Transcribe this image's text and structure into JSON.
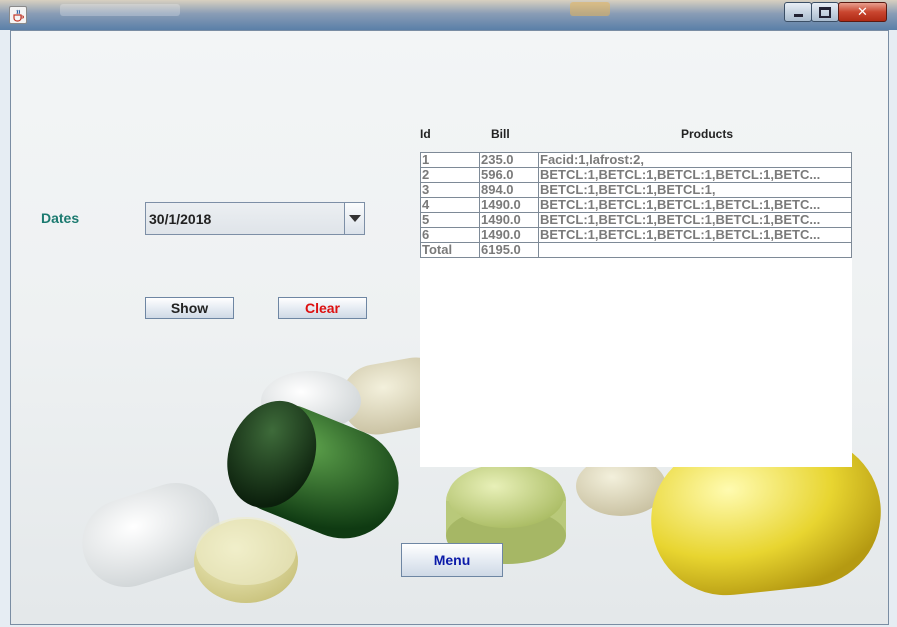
{
  "window": {
    "icons": {
      "app": "java-cup-icon",
      "minimize": "minimize-icon",
      "maximize": "maximize-icon",
      "close": "close-icon"
    },
    "close_glyph": "✕"
  },
  "form": {
    "dates_label": "Dates",
    "date_value": "30/1/2018",
    "show_label": "Show",
    "clear_label": "Clear",
    "menu_label": "Menu"
  },
  "table": {
    "headers": {
      "id": "Id",
      "bill": "Bill",
      "products": "Products"
    },
    "rows": [
      {
        "id": "1",
        "bill": "235.0",
        "products": "Facid:1,lafrost:2,"
      },
      {
        "id": "2",
        "bill": "596.0",
        "products": "BETCL:1,BETCL:1,BETCL:1,BETCL:1,BETC..."
      },
      {
        "id": "3",
        "bill": "894.0",
        "products": "BETCL:1,BETCL:1,BETCL:1,"
      },
      {
        "id": "4",
        "bill": "1490.0",
        "products": "BETCL:1,BETCL:1,BETCL:1,BETCL:1,BETC..."
      },
      {
        "id": "5",
        "bill": "1490.0",
        "products": "BETCL:1,BETCL:1,BETCL:1,BETCL:1,BETC..."
      },
      {
        "id": "6",
        "bill": "1490.0",
        "products": "BETCL:1,BETCL:1,BETCL:1,BETCL:1,BETC..."
      },
      {
        "id": "Total",
        "bill": "6195.0",
        "products": ""
      }
    ]
  },
  "colors": {
    "dates_label": "#1c7a70",
    "clear_text": "#dd1010",
    "menu_text": "#0b1aa8",
    "cell_text": "#7a7a7a"
  }
}
